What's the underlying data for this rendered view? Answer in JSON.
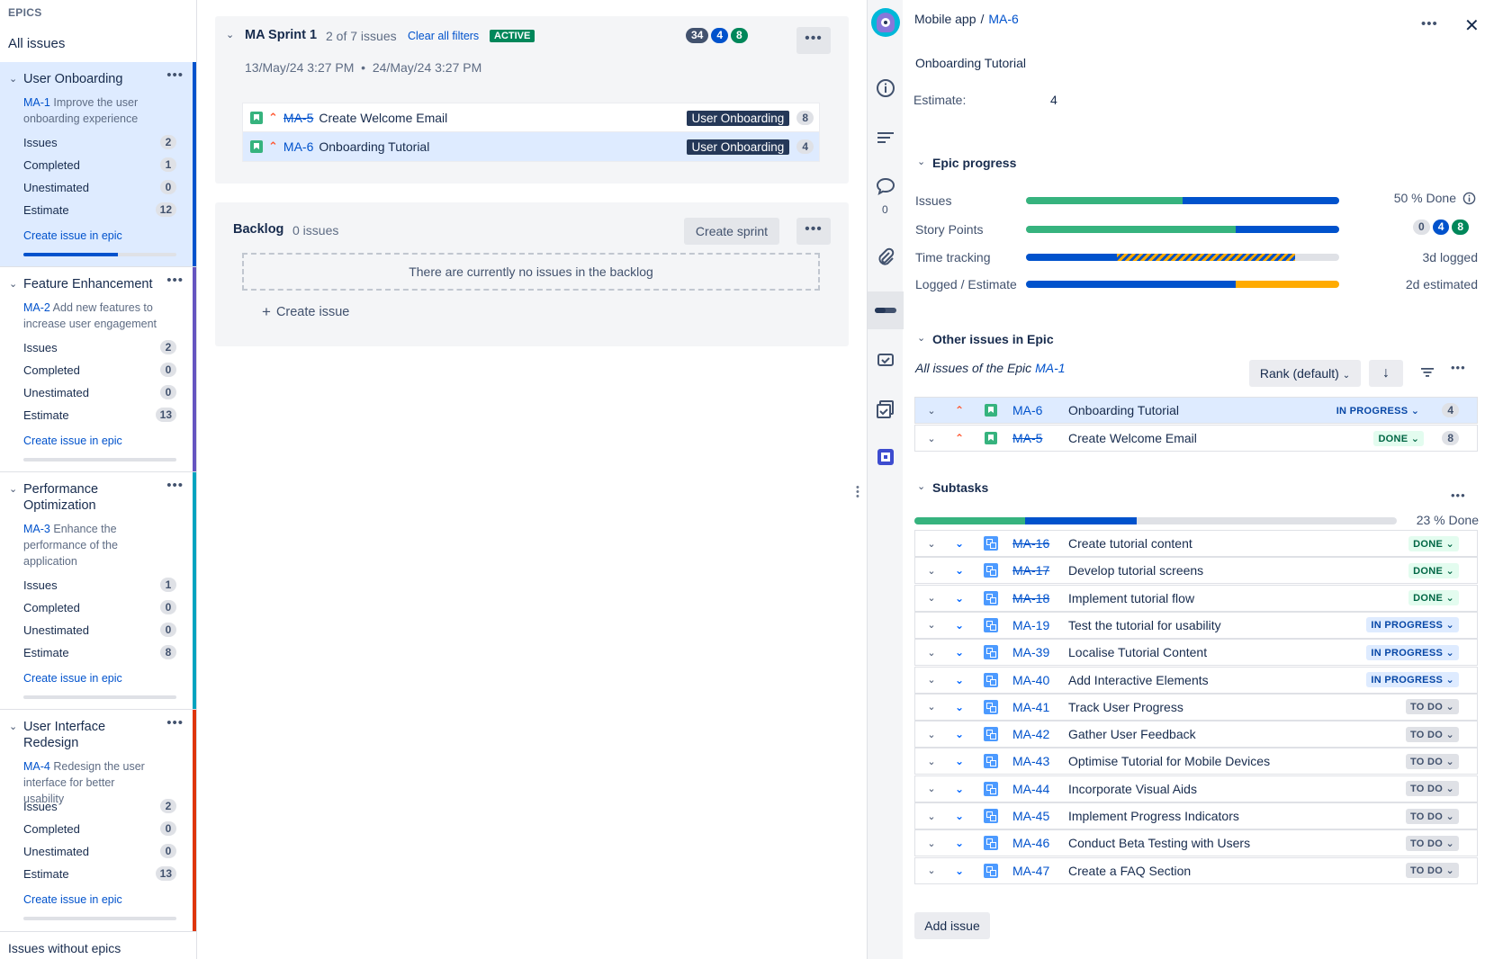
{
  "epics_panel": {
    "title": "EPICS",
    "all_issues": "All issues",
    "no_epics": "Issues without epics",
    "epics": [
      {
        "name": "User Onboarding",
        "key": "MA-1",
        "desc": "Improve the user onboarding experience",
        "issues": "2",
        "completed": "1",
        "unestimated": "0",
        "estimate": "12",
        "create": "Create issue in epic",
        "progress": 0.62,
        "color": "#0052cc"
      },
      {
        "name": "Feature Enhancement",
        "key": "MA-2",
        "desc": "Add new features to increase user engagement",
        "issues": "2",
        "completed": "0",
        "unestimated": "0",
        "estimate": "13",
        "create": "Create issue in epic",
        "progress": 0,
        "color": "#6554c0"
      },
      {
        "name": "Performance Optimization",
        "key": "MA-3",
        "desc": "Enhance the performance of the application",
        "issues": "1",
        "completed": "0",
        "unestimated": "0",
        "estimate": "8",
        "create": "Create issue in epic",
        "progress": 0,
        "color": "#00a3bf"
      },
      {
        "name": "User Interface Redesign",
        "key": "MA-4",
        "desc": "Redesign the user interface for better usability",
        "issues": "2",
        "completed": "0",
        "unestimated": "0",
        "estimate": "13",
        "create": "Create issue in epic",
        "progress": 0,
        "color": "#de350b"
      }
    ],
    "labels": {
      "issues": "Issues",
      "completed": "Completed",
      "unestimated": "Unestimated",
      "estimate": "Estimate"
    }
  },
  "sprint": {
    "name": "MA Sprint 1",
    "count": "2 of 7 issues",
    "clear": "Clear all filters",
    "status": "ACTIVE",
    "badges": [
      "34",
      "4",
      "8"
    ],
    "dates": "13/May/24 3:27 PM  •  24/May/24 3:27 PM",
    "issues": [
      {
        "key": "MA-5",
        "title": "Create Welcome Email",
        "epic": "User Onboarding",
        "est": "8",
        "strike": true
      },
      {
        "key": "MA-6",
        "title": "Onboarding Tutorial",
        "epic": "User Onboarding",
        "est": "4",
        "strike": false
      }
    ]
  },
  "backlog": {
    "title": "Backlog",
    "count": "0 issues",
    "create_sprint": "Create sprint",
    "empty": "There are currently no issues in the backlog",
    "create_issue": "Create issue"
  },
  "detail": {
    "project": "Mobile app",
    "sep": "/",
    "key": "MA-6",
    "title": "Onboarding Tutorial",
    "estimate_label": "Estimate:",
    "estimate_value": "4",
    "comment_count": "0",
    "epic_progress": {
      "title": "Epic progress",
      "issues_label": "Issues",
      "issues_right": "50 % Done",
      "story_label": "Story Points",
      "story_badges": [
        "0",
        "4",
        "8"
      ],
      "time_label": "Time tracking",
      "time_right": "3d logged",
      "logged_label": "Logged / Estimate",
      "logged_right": "2d estimated"
    },
    "other": {
      "title": "Other issues in Epic",
      "subtitle_prefix": "All issues of the Epic",
      "subtitle_key": "MA-1",
      "rank": "Rank (default)",
      "rows": [
        {
          "key": "MA-6",
          "title": "Onboarding Tutorial",
          "status": "IN PROGRESS",
          "est": "4",
          "strike": false
        },
        {
          "key": "MA-5",
          "title": "Create Welcome Email",
          "status": "DONE",
          "est": "8",
          "strike": true
        }
      ]
    },
    "subtasks": {
      "title": "Subtasks",
      "done": "23 % Done",
      "add": "Add issue",
      "rows": [
        {
          "key": "MA-16",
          "title": "Create tutorial content",
          "status": "DONE",
          "strike": true
        },
        {
          "key": "MA-17",
          "title": "Develop tutorial screens",
          "status": "DONE",
          "strike": true
        },
        {
          "key": "MA-18",
          "title": "Implement tutorial flow",
          "status": "DONE",
          "strike": true
        },
        {
          "key": "MA-19",
          "title": "Test the tutorial for usability",
          "status": "IN PROGRESS",
          "strike": false
        },
        {
          "key": "MA-39",
          "title": "Localise Tutorial Content",
          "status": "IN PROGRESS",
          "strike": false
        },
        {
          "key": "MA-40",
          "title": "Add Interactive Elements",
          "status": "IN PROGRESS",
          "strike": false
        },
        {
          "key": "MA-41",
          "title": "Track User Progress",
          "status": "TO DO",
          "strike": false
        },
        {
          "key": "MA-42",
          "title": "Gather User Feedback",
          "status": "TO DO",
          "strike": false
        },
        {
          "key": "MA-43",
          "title": "Optimise Tutorial for Mobile Devices",
          "status": "TO DO",
          "strike": false
        },
        {
          "key": "MA-44",
          "title": "Incorporate Visual Aids",
          "status": "TO DO",
          "strike": false
        },
        {
          "key": "MA-45",
          "title": "Implement Progress Indicators",
          "status": "TO DO",
          "strike": false
        },
        {
          "key": "MA-46",
          "title": "Conduct Beta Testing with Users",
          "status": "TO DO",
          "strike": false
        },
        {
          "key": "MA-47",
          "title": "Create a FAQ Section",
          "status": "TO DO",
          "strike": false
        }
      ]
    }
  },
  "colors": {
    "green": "#36b37e",
    "blue": "#0052cc",
    "orange": "#ffab00",
    "grey": "#dfe1e6"
  }
}
